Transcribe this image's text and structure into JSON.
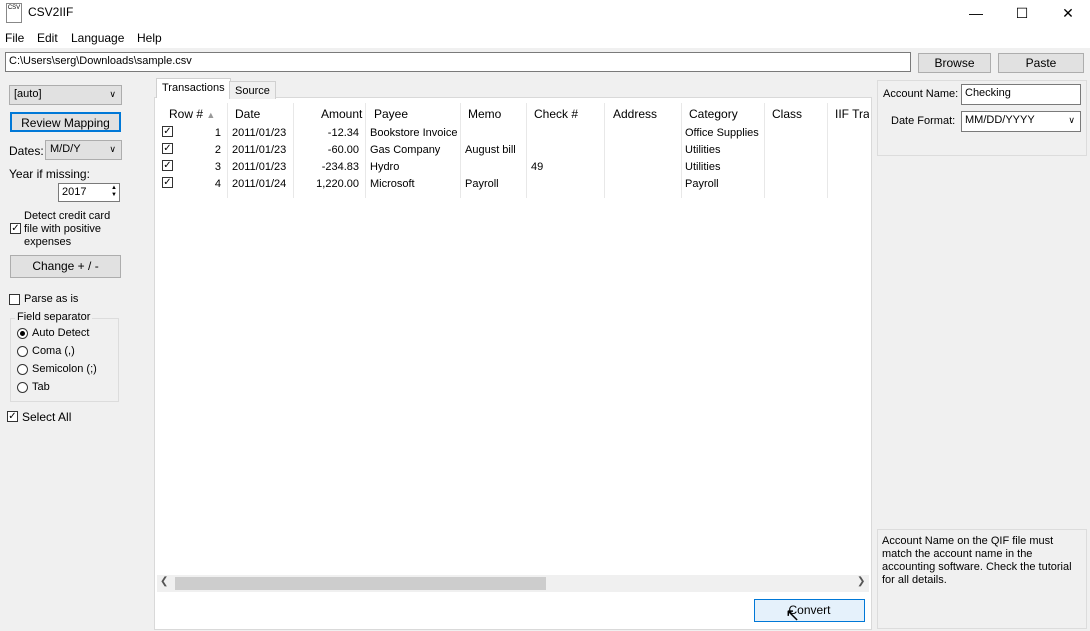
{
  "window": {
    "title": "CSV2IIF",
    "icon_text": "CSV",
    "controls": [
      "—",
      "☐",
      "✕"
    ]
  },
  "menu": [
    "File",
    "Edit",
    "Language",
    "Help"
  ],
  "path": {
    "value": "C:\\Users\\serg\\Downloads\\sample.csv",
    "browse_label": "Browse",
    "paste_label": "Paste"
  },
  "left": {
    "format_select": "[auto]",
    "review_mapping_label": "Review Mapping",
    "dates_label": "Dates:",
    "dates_value": "M/D/Y",
    "year_label": "Year if missing:",
    "year_value": "2017",
    "detect_label_1": "Detect credit card",
    "detect_label_2": "file with positive",
    "detect_label_3": "expenses",
    "detect_checked": true,
    "change_label": "Change + / -",
    "parse_label": "Parse as is",
    "field_separator_label": "Field separator",
    "separators": [
      "Auto Detect",
      "Coma (,)",
      "Semicolon (;)",
      "Tab"
    ],
    "selected_separator": "Auto Detect",
    "select_all_label": "Select All",
    "select_all_checked": true
  },
  "tabs": [
    "Transactions",
    "Source"
  ],
  "active_tab": "Transactions",
  "table": {
    "columns": [
      "Row #",
      "Date",
      "Amount",
      "Payee",
      "Memo",
      "Check #",
      "Address",
      "Category",
      "Class",
      "IIF Tran"
    ],
    "rows": [
      {
        "checked": true,
        "row": "1",
        "date": "2011/01/23",
        "amount": "-12.34",
        "payee": "Bookstore Invoice",
        "memo": "",
        "check": "",
        "address": "",
        "category": "Office Supplies",
        "class": ""
      },
      {
        "checked": true,
        "row": "2",
        "date": "2011/01/23",
        "amount": "-60.00",
        "payee": "Gas Company",
        "memo": "August bill",
        "check": "",
        "address": "",
        "category": "Utilities",
        "class": ""
      },
      {
        "checked": true,
        "row": "3",
        "date": "2011/01/23",
        "amount": "-234.83",
        "payee": "Hydro",
        "memo": "",
        "check": "49",
        "address": "",
        "category": "Utilities",
        "class": ""
      },
      {
        "checked": true,
        "row": "4",
        "date": "2011/01/24",
        "amount": "1,220.00",
        "payee": "Microsoft",
        "memo": "Payroll",
        "check": "",
        "address": "",
        "category": "Payroll",
        "class": ""
      }
    ]
  },
  "right": {
    "account_name_label": "Account Name:",
    "account_name_value": "Checking",
    "date_format_label": "Date Format:",
    "date_format_value": "MM/DD/YYYY",
    "help_text": "Account Name on the QIF file must match the account name in the accounting software. Check the tutorial for all details."
  },
  "convert_label": "Convert",
  "colors": {
    "accent_border": "#0078d7",
    "button_face": "#e1e1e1",
    "window_bg": "#f0f0f0"
  }
}
